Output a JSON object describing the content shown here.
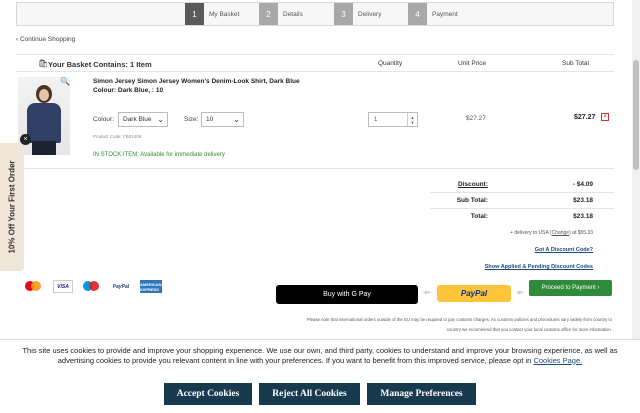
{
  "steps": [
    {
      "num": "1",
      "label": "My Basket"
    },
    {
      "num": "2",
      "label": "Details"
    },
    {
      "num": "3",
      "label": "Delivery"
    },
    {
      "num": "4",
      "label": "Payment"
    }
  ],
  "continue_shopping": "‹ Continue Shopping",
  "basket": {
    "title": "Your Basket Contains: 1 Item",
    "col_quantity": "Quantity",
    "col_unit_price": "Unit Price",
    "col_sub_total": "Sub Total"
  },
  "product": {
    "name": "Simon Jersey Simon Jersey Women's Denim-Look Shirt, Dark Blue",
    "colour_line": "Colour: Dark Blue, : 10",
    "colour_label": "Colour:",
    "colour_value": "Dark Blue",
    "size_label": "Size:",
    "size_value": "10",
    "code": "Product Code: FB01405",
    "stock": "IN STOCK ITEM; Available for immediate delivery",
    "quantity": "1",
    "unit_price": "$27.27",
    "sub_total": "$27.27"
  },
  "summary": {
    "discount_label": "Discount:",
    "discount_value": "- $4.09",
    "subtotal_label": "Sub Total:",
    "subtotal_value": "$23.18",
    "total_label": "Total:",
    "total_value": "$23.18",
    "delivery_prefix": "+ delivery to USA (",
    "delivery_change": "Change",
    "delivery_suffix": ") at $55.33",
    "discount_code_link": "Got A Discount Code?",
    "applied_codes_link": "Show Applied & Pending Discount Codes"
  },
  "payment": {
    "visa": "VISA",
    "paypal_logo": "PayPal",
    "amex": "AMERICAN EXPRESS",
    "gpay_label": "Buy with G Pay",
    "or": "-or-",
    "paypal_button": "PayPal",
    "proceed_label": "Proceed to Payment ›",
    "intl_note_1": "Please note that international orders outside of the EU may be required to pay customs charges. As customs policies and procedures vary widely from country to",
    "intl_note_2": "country we recommend that you contact your local customs office for more information."
  },
  "side_tab": {
    "text": "10% Off Your First Order",
    "close": "×"
  },
  "cookie": {
    "message": "This site uses cookies to provide and improve your shopping experience. We use our own, and third party, cookies to understand and improve your browsing experience, as well as advertising cookies to provide you relevant content in line with your preferences. If you want to benefit from this improved service, please opt in",
    "link": "Cookies Page.",
    "accept": "Accept Cookies",
    "reject": "Reject All Cookies",
    "manage": "Manage Preferences"
  },
  "colors": {
    "accent_green": "#2e8b3a",
    "cookie_btn": "#173a4f",
    "paypal_yellow": "#ffc439"
  }
}
